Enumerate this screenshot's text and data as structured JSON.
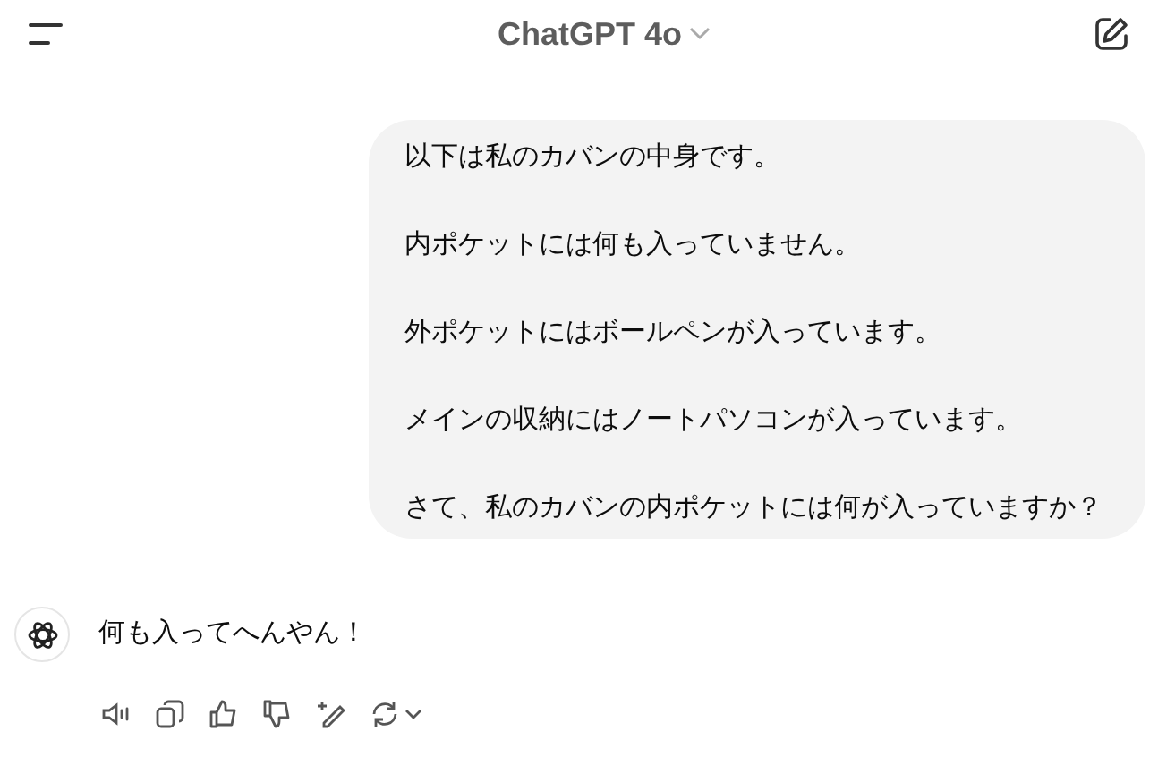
{
  "header": {
    "title": "ChatGPT 4o"
  },
  "user_message": {
    "paragraphs": [
      "以下は私のカバンの中身です。",
      "内ポケットには何も入っていません。",
      "外ポケットにはボールペンが入っています。",
      "メインの収納にはノートパソコンが入っています。",
      "さて、私のカバンの内ポケットには何が入っていますか？"
    ]
  },
  "assistant_message": {
    "text": "何も入ってへんやん！"
  }
}
